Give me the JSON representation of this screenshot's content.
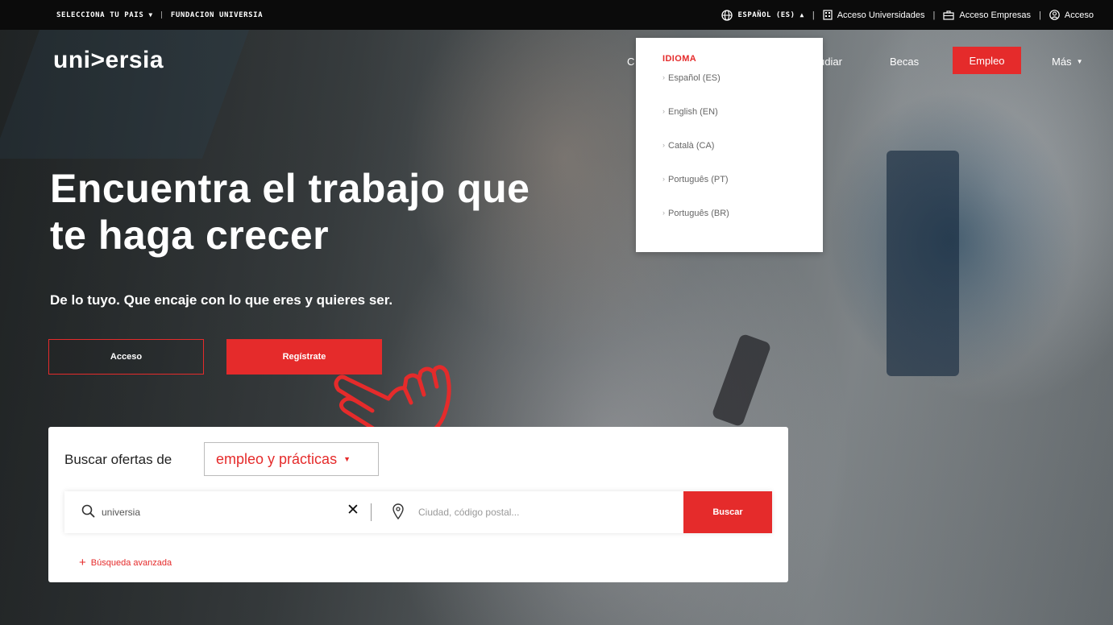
{
  "topbar": {
    "country_select": "SELECCIONA TU PAIS",
    "separator": "|",
    "foundation": "FUNDACION UNIVERSIA",
    "language": "ESPAÑOL (ES)",
    "universities": "Acceso Universidades",
    "companies": "Acceso Empresas",
    "login": "Acceso"
  },
  "logo": "uni>ersia",
  "nav": {
    "item_c": "C",
    "estudiar": "udiar",
    "becas": "Becas",
    "empleo": "Empleo",
    "mas": "Más"
  },
  "language_dropdown": {
    "title": "IDIOMA",
    "options": [
      "Español (ES)",
      "English (EN)",
      "Català (CA)",
      "Português (PT)",
      "Português (BR)"
    ]
  },
  "hero": {
    "headline_line1": "Encuentra el trabajo que",
    "headline_line2": "te haga crecer",
    "subline": "De lo tuyo. Que encaje con lo que eres y quieres ser.",
    "login_button": "Acceso",
    "register_button": "Regístrate"
  },
  "search": {
    "label": "Buscar ofertas de",
    "type_value": "empleo y prácticas",
    "query_value": "universia",
    "location_placeholder": "Ciudad, código postal...",
    "clear_symbol": "✕",
    "submit": "Buscar",
    "advanced": "Búsqueda avanzada",
    "advanced_plus": "+"
  },
  "colors": {
    "accent": "#e52b2b",
    "topbar_bg": "#0b0b0b"
  },
  "icons": [
    "globe-icon",
    "building-icon",
    "briefcase-icon",
    "user-circle-icon",
    "search-icon",
    "location-pin-icon",
    "pointing-hand-icon"
  ]
}
